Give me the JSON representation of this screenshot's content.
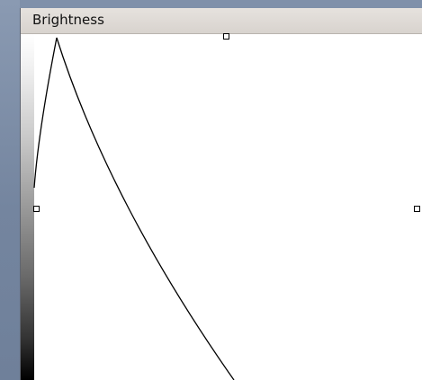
{
  "panel": {
    "title": "Brightness"
  },
  "colors": {
    "background": "#7d8ea8",
    "titlebar": "#dcd8d3",
    "curve": "#000000",
    "canvas": "#ffffff"
  },
  "curve": {
    "shape": "peak-then-decay",
    "handles": [
      "top-handle",
      "left-handle",
      "right-handle"
    ]
  }
}
